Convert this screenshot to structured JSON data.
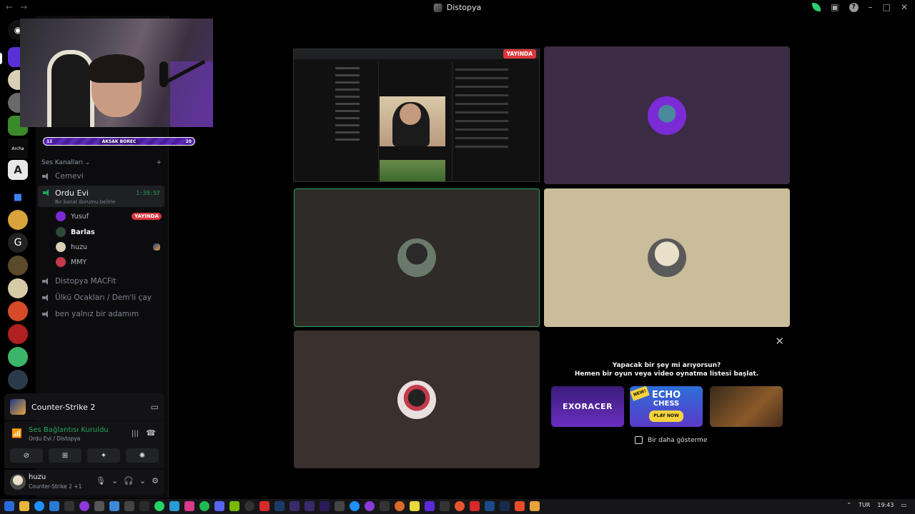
{
  "window": {
    "title": "Distopya"
  },
  "sidebar": {
    "boost": {
      "left": "11",
      "label": "AKSAK BOREC",
      "right": "20"
    },
    "voice_section_label": "Ses Kanalları",
    "channels": [
      {
        "name": "Cemevi"
      },
      {
        "name": "Ordu Evi",
        "timer": "1:39:57",
        "status": "Bir kanal durumu belirle"
      },
      {
        "name": "Distopya MACFit"
      },
      {
        "name": "Ülkü Ocakları / Dem'li çay"
      },
      {
        "name": "ben yalnız bir adamım"
      }
    ],
    "members": [
      {
        "name": "Yusuf",
        "badge": "YAYINDA",
        "color": "#7b2bd6"
      },
      {
        "name": "Barlas",
        "color": "#2d4a3a"
      },
      {
        "name": "huzu",
        "color": "#d8cfb5"
      },
      {
        "name": "MMY",
        "color": "#c43a4a"
      }
    ]
  },
  "game_activity": {
    "name": "Counter-Strike 2"
  },
  "voice_connection": {
    "title": "Ses Bağlantısı Kuruldu",
    "subtitle": "Ordu Evi / Distopya"
  },
  "user": {
    "name": "huzu",
    "status": "Counter-Strike 2 +1"
  },
  "stream": {
    "live_badge": "YAYINDA"
  },
  "tiles_colors": {
    "purple": "#3b2b44",
    "selected": "#2e2b29",
    "tan": "#c9bd9b",
    "plain": "#3a302d",
    "accent_green": "#23a559",
    "live_red": "#da373c"
  },
  "activity_prompt": {
    "line1": "Yapacak bir şey mi arıyorsun?",
    "line2": "Hemen bir oyun veya video oynatma listesi başlat.",
    "games": [
      {
        "title": "EXORACER"
      },
      {
        "title": "ECHO",
        "subtitle": "CHESS",
        "cta": "PLAY NOW",
        "flag": "NEW!"
      },
      {
        "title": ""
      }
    ],
    "dont_show": "Bir daha gösterme"
  },
  "taskbar": {
    "lang": "TUR",
    "time": "19:43"
  }
}
